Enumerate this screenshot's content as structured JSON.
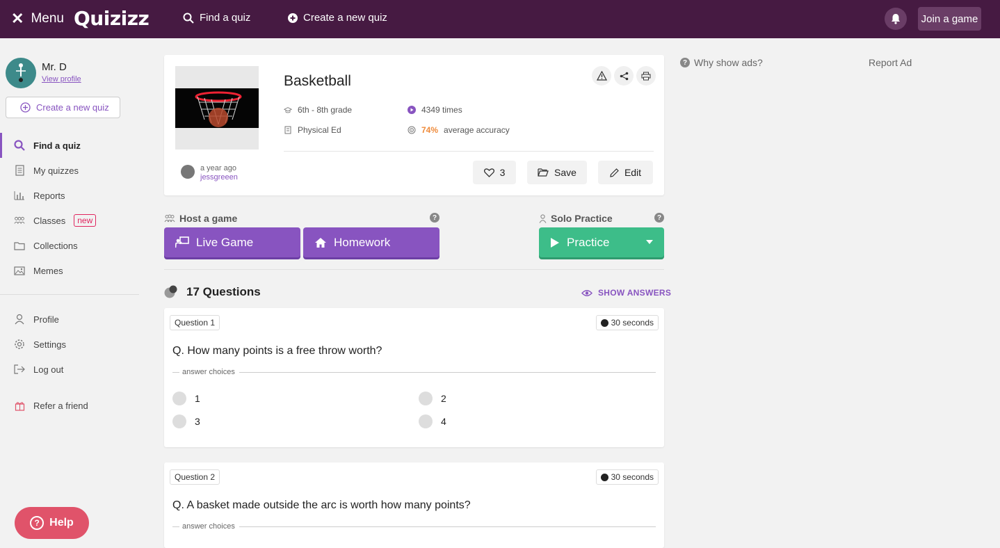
{
  "topbar": {
    "menu_label": "Menu",
    "logo_text": "Quizizz",
    "find_quiz": "Find a quiz",
    "create_quiz": "Create a new quiz",
    "join_game": "Join a game"
  },
  "sidebar": {
    "user_name": "Mr. D",
    "view_profile": "View profile",
    "create_quiz": "Create a new quiz",
    "items": [
      {
        "label": "Find a quiz",
        "icon": "search-icon"
      },
      {
        "label": "My quizzes",
        "icon": "document-icon"
      },
      {
        "label": "Reports",
        "icon": "bar-chart-icon"
      },
      {
        "label": "Classes",
        "icon": "people-icon",
        "badge": "new"
      },
      {
        "label": "Collections",
        "icon": "folder-icon"
      },
      {
        "label": "Memes",
        "icon": "image-icon"
      }
    ],
    "bottom_items": [
      {
        "label": "Profile",
        "icon": "user-icon"
      },
      {
        "label": "Settings",
        "icon": "gear-icon"
      },
      {
        "label": "Log out",
        "icon": "logout-icon"
      },
      {
        "label": "Refer a friend",
        "icon": "gift-icon"
      }
    ],
    "help": "Help"
  },
  "quiz": {
    "title": "Basketball",
    "grade": "6th - 8th grade",
    "subject": "Physical Ed",
    "plays": "4349 times",
    "accuracy_pct": "74%",
    "accuracy_label": "average accuracy",
    "author_time": "a year ago",
    "author_name": "jessgreeen",
    "likes": "3",
    "save": "Save",
    "edit": "Edit"
  },
  "host": {
    "label": "Host a game",
    "live": "Live Game",
    "homework": "Homework"
  },
  "solo": {
    "label": "Solo Practice",
    "practice": "Practice"
  },
  "questions_header": {
    "count": "17 Questions",
    "show_answers": "SHOW ANSWERS"
  },
  "questions": [
    {
      "tag": "Question 1",
      "time": "30 seconds",
      "text": "Q. How many points is a free throw worth?",
      "answer_label": "answer choices",
      "choices": [
        "1",
        "2",
        "3",
        "4"
      ]
    },
    {
      "tag": "Question 2",
      "time": "30 seconds",
      "text": "Q. A basket made outside the arc is worth how many points?",
      "answer_label": "answer choices"
    }
  ],
  "ads": {
    "why": "Why show ads?",
    "report": "Report Ad"
  },
  "colors": {
    "topbar": "#461a42",
    "accent": "#8854c0",
    "green": "#3dbd89",
    "accuracy": "#ef8b3b"
  }
}
